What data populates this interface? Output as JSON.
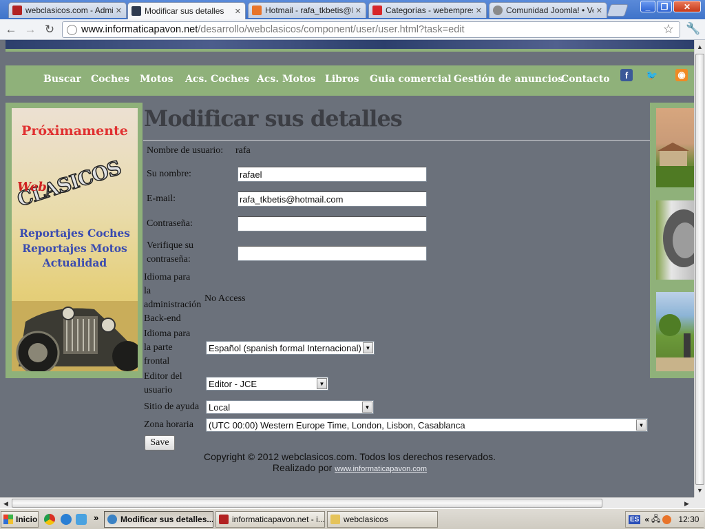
{
  "browser": {
    "tabs": [
      {
        "label": "webclasicos.com - Adminis",
        "favicon_color": "#b22222"
      },
      {
        "label": "Modificar sus detalles",
        "favicon_color": "#2e3a4f",
        "active": true
      },
      {
        "label": "Hotmail - rafa_tkbetis@hot",
        "favicon_color": "#e8742a"
      },
      {
        "label": "Categorías - webempresa",
        "favicon_color": "#d7262a"
      },
      {
        "label": "Comunidad Joomla! • Ver",
        "favicon_color": "#8a8a8a"
      }
    ],
    "tab_close": "✕",
    "url_host": "www.informaticapavon.net",
    "url_path": "/desarrollo/webclasicos/component/user/user.html?task=edit",
    "win_minimize": "_",
    "win_maximize": "❐",
    "win_close": "✕"
  },
  "site": {
    "nav": [
      "Buscar",
      "Coches",
      "Motos",
      "Acs. Coches",
      "Acs. Motos",
      "Libros",
      "Guia comercial",
      "Gestión de anuncios",
      "Contacto"
    ],
    "social": {
      "facebook": "f",
      "twitter": "🐦",
      "rss": "◉"
    },
    "banner": {
      "proximamente": "Próximamente",
      "web": "Web",
      "clasicos": "CLASICOS",
      "lines": [
        "Reportajes Coches",
        "Reportajes Motos",
        "Actualidad"
      ]
    },
    "page_title": "Modificar sus detalles",
    "form": {
      "username_label": "Nombre de usuario:",
      "username_value": "rafa",
      "name_label": "Su nombre:",
      "name_value": "rafael",
      "email_label": "E-mail:",
      "email_value": "rafa_tkbetis@hotmail.com",
      "password_label": "Contraseña:",
      "password_value": "",
      "verify_label_1": "Verifique su",
      "verify_label_2": "contraseña:",
      "verify_value": "",
      "admin_lang_label": [
        "Idioma para",
        "la",
        "administración",
        "Back-end"
      ],
      "admin_lang_value": "No Access",
      "front_lang_label": [
        "Idioma para",
        "la parte",
        "frontal"
      ],
      "front_lang_value": "Español (spanish formal Internacional)",
      "editor_label": [
        "Editor del",
        "usuario"
      ],
      "editor_value": "Editor - JCE",
      "help_label": "Sitio de ayuda",
      "help_value": "Local",
      "tz_label": "Zona horaria",
      "tz_value": "(UTC 00:00) Western Europe Time, London, Lisbon, Casablanca",
      "save_label": "Save"
    },
    "footer_line1": "Copyright © 2012 webclasicos.com. Todos los derechos reservados.",
    "footer_line2_prefix": "Realizado por",
    "footer_link": "www.informaticapavon.com"
  },
  "taskbar": {
    "start_label": "Inicio",
    "chevron": "»",
    "items": [
      {
        "label": "Modificar sus detalles...",
        "color": "#3b82c4",
        "active": true
      },
      {
        "label": "informaticapavon.net - i...",
        "color": "#b22222"
      },
      {
        "label": "webclasicos",
        "color": "#e5c35a"
      }
    ],
    "lang": "ES",
    "tray_chevron": "«",
    "clock": "12:30"
  }
}
